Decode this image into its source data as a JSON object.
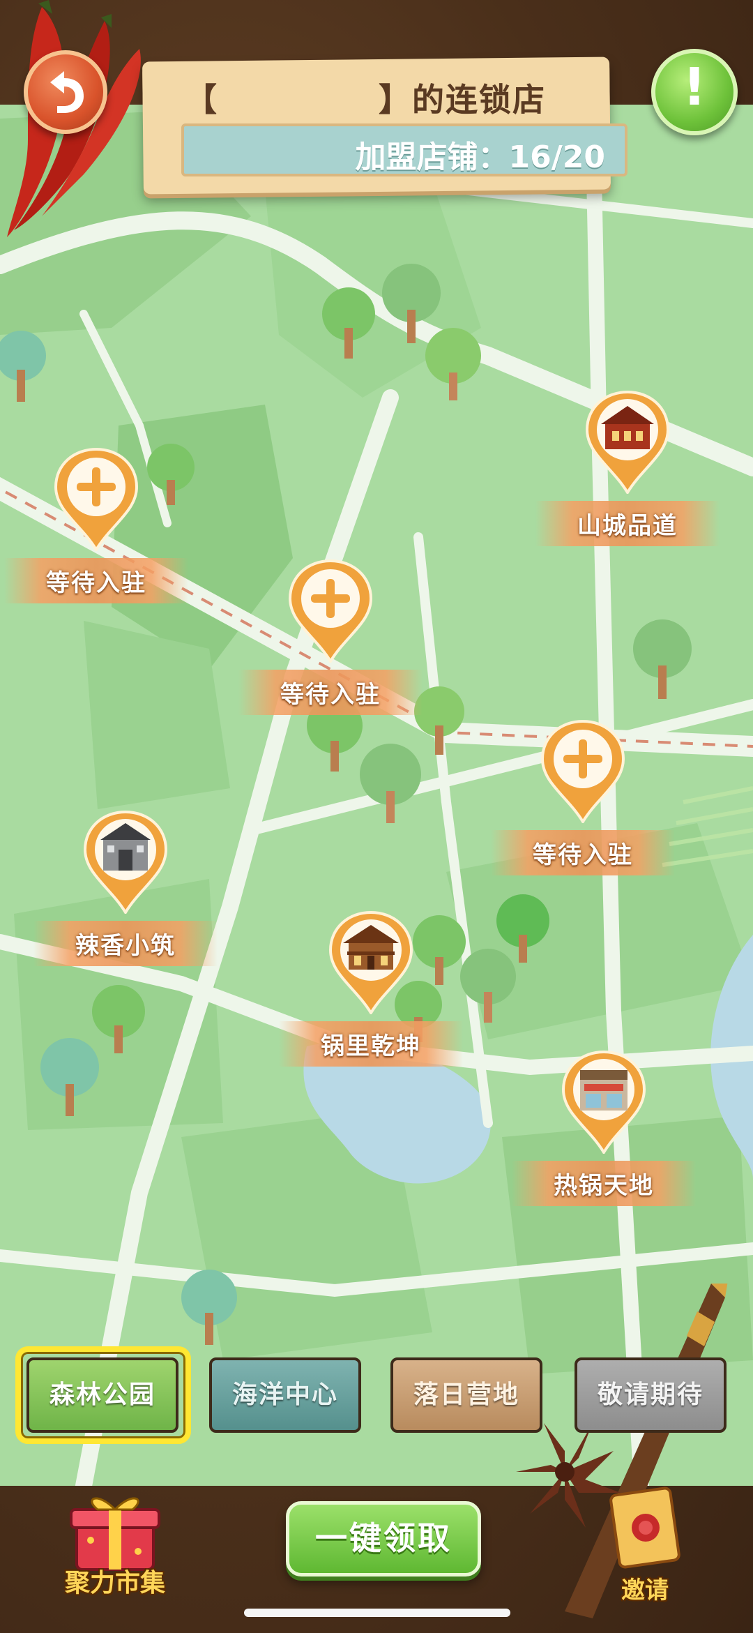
{
  "header": {
    "title_open": "【",
    "title_name": "",
    "title_close": "】的连锁店",
    "franchise_label": "加盟店铺：",
    "franchise_count": "16/20"
  },
  "pins": [
    {
      "id": "pin-1",
      "type": "empty",
      "label": "等待入驻"
    },
    {
      "id": "pin-2",
      "type": "empty",
      "label": "等待入驻"
    },
    {
      "id": "pin-3",
      "type": "empty",
      "label": "等待入驻"
    },
    {
      "id": "pin-4",
      "type": "shop",
      "label": "山城品道",
      "icon": "red-pavilion-icon"
    },
    {
      "id": "pin-5",
      "type": "shop",
      "label": "辣香小筑",
      "icon": "grey-gate-icon"
    },
    {
      "id": "pin-6",
      "type": "shop",
      "label": "锅里乾坤",
      "icon": "wooden-restaurant-icon"
    },
    {
      "id": "pin-7",
      "type": "shop",
      "label": "热锅天地",
      "icon": "modern-shop-icon"
    }
  ],
  "tabs": [
    {
      "label": "森林公园",
      "selected": true
    },
    {
      "label": "海洋中心",
      "selected": false
    },
    {
      "label": "落日营地",
      "selected": false
    },
    {
      "label": "敬请期待",
      "selected": false
    }
  ],
  "bottom": {
    "market_label": "聚力市集",
    "claim_label": "一键领取",
    "invite_label": "邀请"
  },
  "colors": {
    "map_grass": "#a9dba0",
    "map_road": "#eef6ea",
    "pin_orange": "#f0a23c",
    "claim_green": "#6ec23a",
    "back_red": "#d9532b"
  }
}
